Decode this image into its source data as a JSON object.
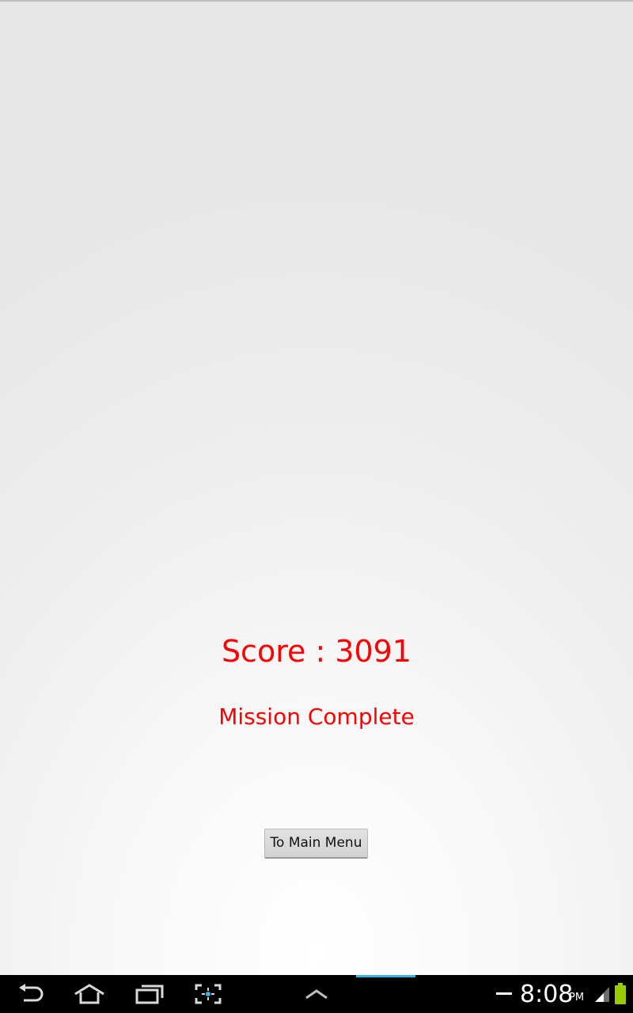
{
  "game_over": {
    "score_text": "Score : 3091",
    "status_text": "Mission Complete",
    "main_menu_button": "To Main Menu"
  },
  "system_bar": {
    "nav_icons": [
      "back-icon",
      "home-icon",
      "recent-apps-icon",
      "screenshot-icon",
      "menu-up-icon"
    ],
    "status_icons": [
      "notification-dash-icon",
      "signal-icon",
      "battery-icon"
    ],
    "time": "8:08",
    "ampm": "PM"
  },
  "colors": {
    "text_accent": "#ff0000",
    "battery": "#99cc00",
    "indicator": "#33b5e5"
  }
}
